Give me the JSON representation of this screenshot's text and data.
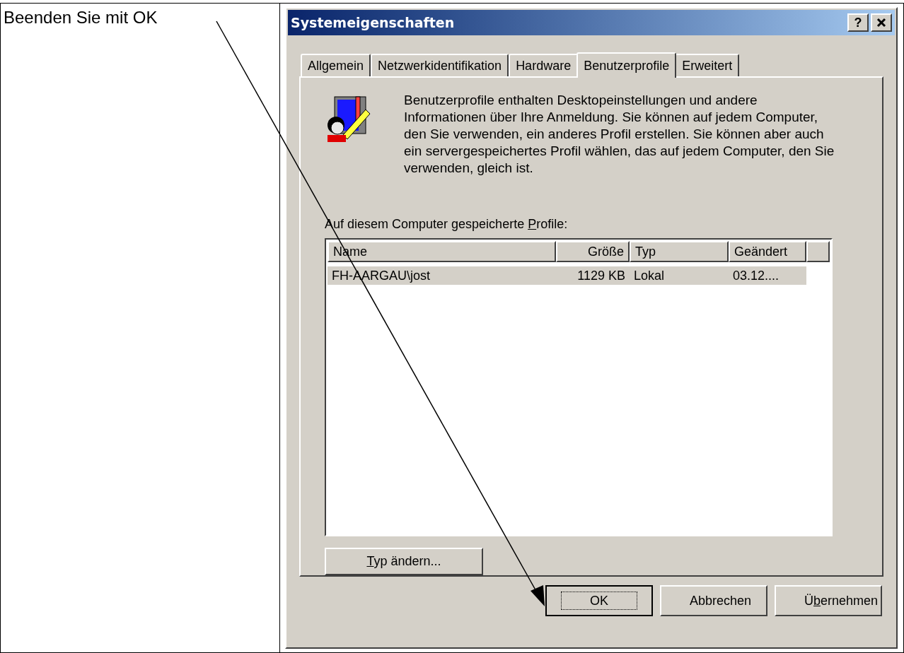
{
  "instruction": "Beenden Sie mit OK",
  "window": {
    "title": "Systemeigenschaften",
    "help_label": "?"
  },
  "tabs": [
    {
      "label": "Allgemein",
      "selected": false
    },
    {
      "label": "Netzwerkidentifikation",
      "selected": false
    },
    {
      "label": "Hardware",
      "selected": false
    },
    {
      "label": "Benutzerprofile",
      "selected": true
    },
    {
      "label": "Erweitert",
      "selected": false
    }
  ],
  "description": "Benutzerprofile enthalten Desktopeinstellungen und andere Informationen über Ihre Anmeldung. Sie können auf jedem Computer, den Sie verwenden, ein anderes Profil erstellen. Sie können aber auch ein servergespeichertes Profil wählen, das auf jedem Computer, den Sie verwenden, gleich ist.",
  "list_label": {
    "before": "Auf diesem Computer gespeicherte ",
    "key": "P",
    "after": "rofile:"
  },
  "table": {
    "columns": [
      {
        "label": "Name",
        "kind": "text"
      },
      {
        "label": "Größe",
        "kind": "number"
      },
      {
        "label": "Typ",
        "kind": "text"
      },
      {
        "label": "Geändert",
        "kind": "text"
      }
    ],
    "rows": [
      {
        "cells": [
          "FH-AARGAU\\jost",
          "1129 KB",
          "Lokal",
          "03.12...."
        ],
        "selected": true
      }
    ]
  },
  "change_type_button": {
    "key": "T",
    "after": "yp ändern..."
  },
  "buttons": [
    {
      "before": "OK",
      "default": true
    },
    {
      "before": "Abbrechen",
      "default": false
    },
    {
      "before": "Ü",
      "key": "b",
      "after": "ernehmen",
      "default": false
    }
  ]
}
